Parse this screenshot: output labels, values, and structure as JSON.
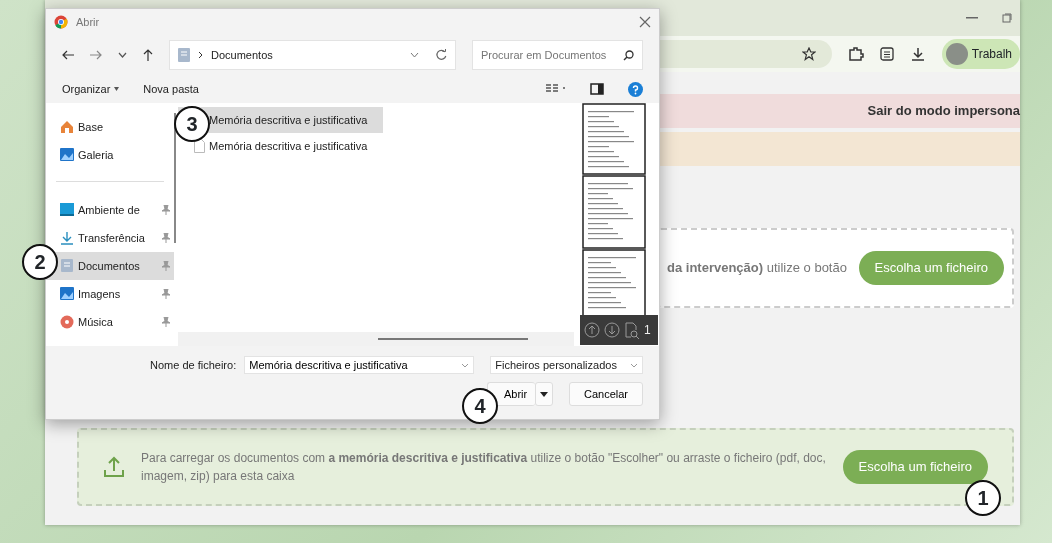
{
  "browser": {
    "profile": {
      "label": "Trabalh"
    },
    "banners": [
      {
        "kind": "danger",
        "text": "Sair do modo impersona"
      },
      {
        "kind": "warning"
      }
    ],
    "dropzones": [
      {
        "kind": "partial",
        "text": "**da intervenção)** utilize o botão",
        "button": "Escolha um ficheiro"
      },
      {
        "kind": "full",
        "text": "Para carregar os documentos com **a memória descritiva e justificativa** utilize o botão \"Escolher\" ou arraste o ficheiro (pdf, doc, imagem, zip) para esta caixa",
        "button": "Escolha um ficheiro"
      }
    ]
  },
  "dialog": {
    "title": "Abrir",
    "path": "Documentos",
    "search": {
      "placeholder": "Procurar em Documentos"
    },
    "commands": [
      "Organizar",
      "Nova pasta"
    ],
    "sidebar": {
      "items": [
        {
          "label": "Base",
          "pinned": false,
          "selected": false
        },
        {
          "label": "Galeria",
          "pinned": false,
          "selected": false
        },
        {
          "label": "Ambiente de",
          "pinned": true,
          "selected": false
        },
        {
          "label": "Transferência",
          "pinned": true,
          "selected": false
        },
        {
          "label": "Documentos",
          "pinned": true,
          "selected": true
        },
        {
          "label": "Imagens",
          "pinned": true,
          "selected": false
        },
        {
          "label": "Música",
          "pinned": true,
          "selected": false
        }
      ]
    },
    "files": [
      {
        "name": "Memória descritiva e justificativa",
        "kind": "pdf",
        "selected": true
      },
      {
        "name": "Memória descritiva e justificativa",
        "kind": "blank",
        "selected": false
      }
    ],
    "preview": {
      "page": "1"
    },
    "filename_label": "Nome de ficheiro:",
    "filename": "Memória descritiva e justificativa",
    "filter": "Ficheiros personalizados",
    "buttons": [
      "Abrir",
      "Cancelar"
    ]
  },
  "callouts": [
    {
      "text": "1"
    },
    {
      "text": "2"
    },
    {
      "text": "3"
    },
    {
      "text": "4"
    }
  ]
}
